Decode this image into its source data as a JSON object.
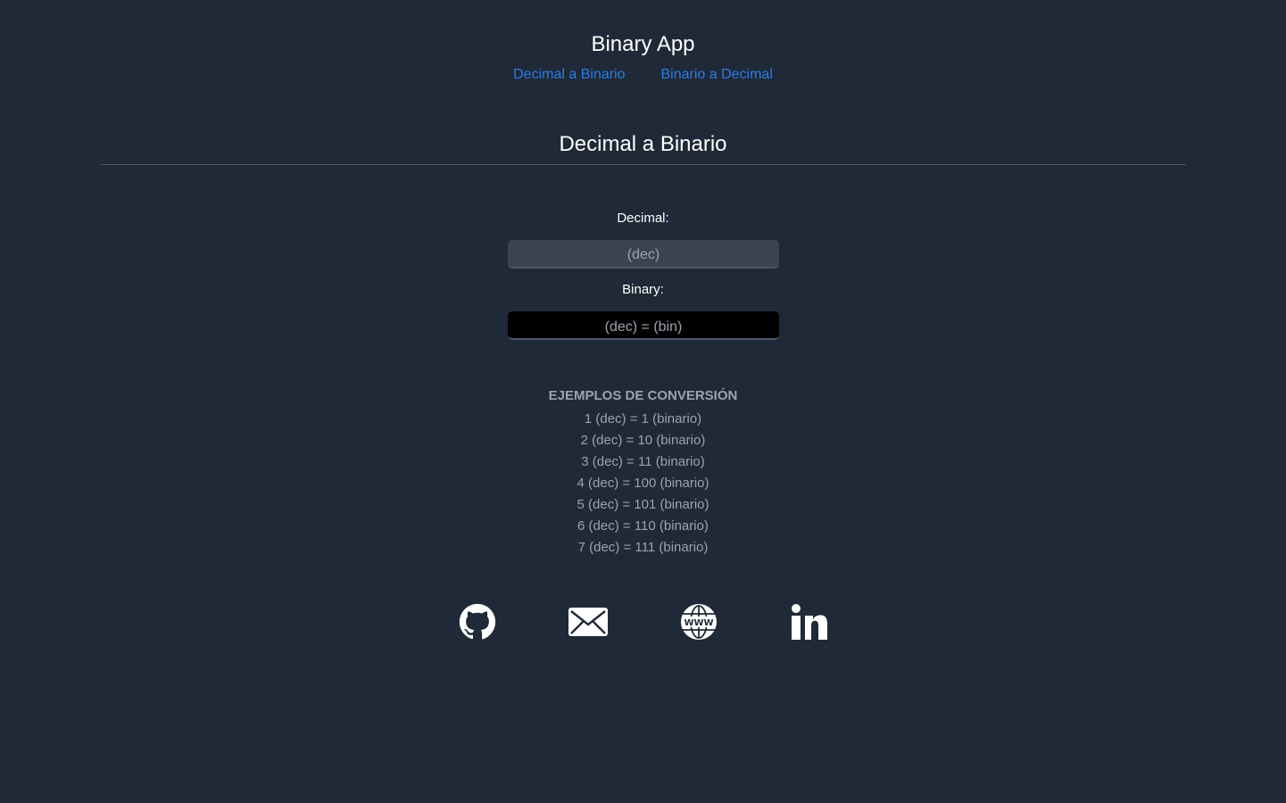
{
  "header": {
    "title": "Binary App",
    "nav": [
      {
        "label": "Decimal a Binario"
      },
      {
        "label": "Binario a Decimal"
      }
    ]
  },
  "section": {
    "title": "Decimal a Binario"
  },
  "form": {
    "decimal_label": "Decimal:",
    "decimal_placeholder": "(dec)",
    "binary_label": "Binary:",
    "binary_output": "(dec) = (bin)"
  },
  "examples": {
    "title": "EJEMPLOS DE CONVERSIÓN",
    "items": [
      "1 (dec) = 1 (binario)",
      "2 (dec) = 10 (binario)",
      "3 (dec) = 11 (binario)",
      "4 (dec) = 100 (binario)",
      "5 (dec) = 101 (binario)",
      "6 (dec) = 110 (binario)",
      "7 (dec) = 111 (binario)"
    ]
  },
  "social": [
    {
      "icon": "github-icon"
    },
    {
      "icon": "mail-icon"
    },
    {
      "icon": "globe-www-icon"
    },
    {
      "icon": "linkedin-icon"
    }
  ],
  "colors": {
    "background": "#1f2937",
    "link": "#2b7de9",
    "muted_text": "#9ca3af"
  }
}
